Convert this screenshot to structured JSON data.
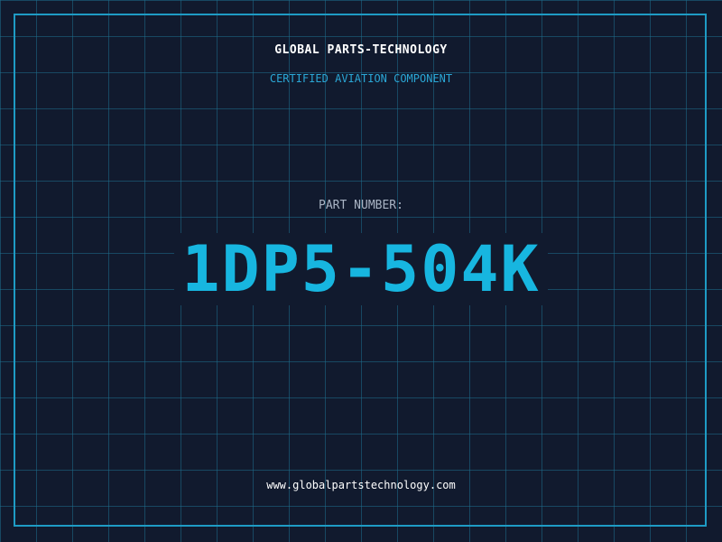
{
  "header": {
    "company": "GLOBAL PARTS-TECHNOLOGY",
    "subtitle": "CERTIFIED AVIATION COMPONENT"
  },
  "part": {
    "label": "PART NUMBER:",
    "number": "1DP5-504K"
  },
  "footer": {
    "url": "www.globalpartstechnology.com"
  },
  "colors": {
    "background": "#111a2e",
    "grid": "#1e6e8c",
    "frame": "#1e9bc4",
    "accent": "#17b6e0",
    "label": "#a9b4c4",
    "text": "#ffffff"
  }
}
